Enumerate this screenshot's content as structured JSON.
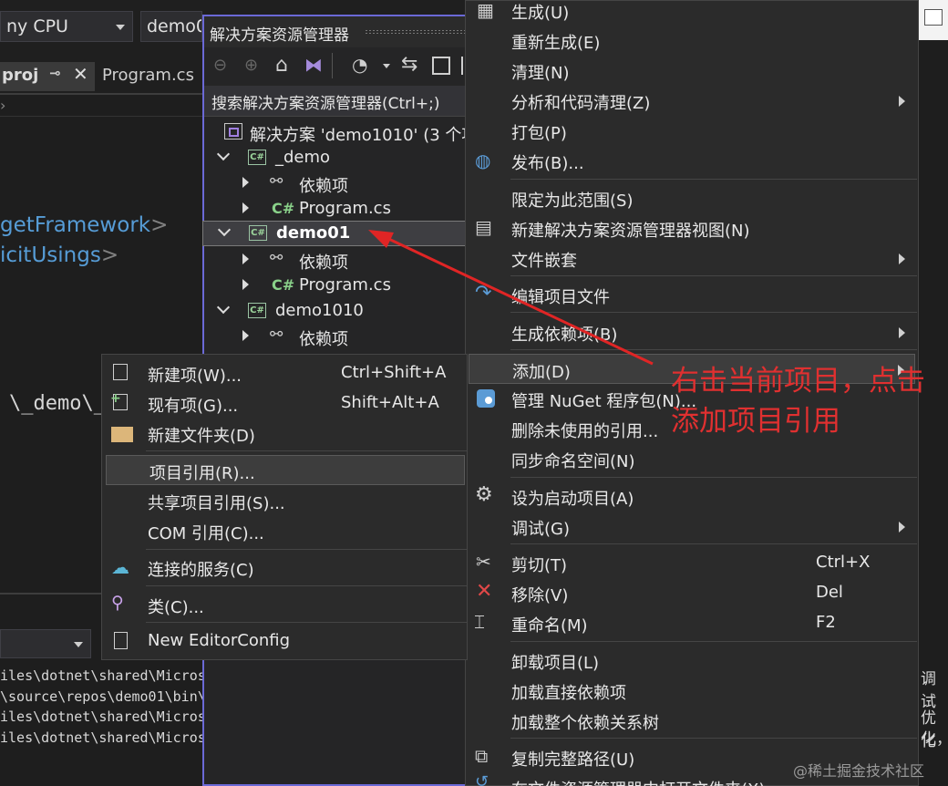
{
  "toolbar": {
    "platform_combo": "ny CPU",
    "project_combo": "demo0"
  },
  "tabs": [
    {
      "label": "proj"
    },
    {
      "label": "Program.cs"
    }
  ],
  "editor": {
    "line1": "getFramework",
    "line2": "icitUsings",
    "path_fragment": "\\_demo\\_"
  },
  "solution_explorer": {
    "title": "解决方案资源管理器",
    "search_placeholder": "搜索解决方案资源管理器(Ctrl+;)",
    "solution_label": "解决方案 'demo1010' (3 个项",
    "csharp_badge": "C#",
    "items": [
      {
        "label": "_demo"
      },
      {
        "label": "依赖项"
      },
      {
        "label": "Program.cs"
      },
      {
        "label": "demo01"
      },
      {
        "label": "依赖项"
      },
      {
        "label": "Program.cs"
      },
      {
        "label": "demo1010"
      },
      {
        "label": "依赖项"
      }
    ]
  },
  "context_menu": {
    "items": [
      {
        "label": "生成(U)"
      },
      {
        "label": "重新生成(E)"
      },
      {
        "label": "清理(N)"
      },
      {
        "label": "分析和代码清理(Z)"
      },
      {
        "label": "打包(P)"
      },
      {
        "label": "发布(B)..."
      },
      {
        "label": "限定为此范围(S)"
      },
      {
        "label": "新建解决方案资源管理器视图(N)"
      },
      {
        "label": "文件嵌套"
      },
      {
        "label": "编辑项目文件"
      },
      {
        "label": "生成依赖项(B)"
      },
      {
        "label": "添加(D)"
      },
      {
        "label": "管理 NuGet 程序包(N)..."
      },
      {
        "label": "删除未使用的引用..."
      },
      {
        "label": "同步命名空间(N)"
      },
      {
        "label": "设为启动项目(A)"
      },
      {
        "label": "调试(G)"
      },
      {
        "label": "剪切(T)",
        "shortcut": "Ctrl+X"
      },
      {
        "label": "移除(V)",
        "shortcut": "Del"
      },
      {
        "label": "重命名(M)",
        "shortcut": "F2"
      },
      {
        "label": "卸载项目(L)"
      },
      {
        "label": "加载直接依赖项"
      },
      {
        "label": "加载整个依赖关系树"
      },
      {
        "label": "复制完整路径(U)"
      },
      {
        "label": "在文件资源管理器中打开文件夹(X)"
      }
    ]
  },
  "add_submenu": {
    "items": [
      {
        "label": "新建项(W)...",
        "shortcut": "Ctrl+Shift+A"
      },
      {
        "label": "现有项(G)...",
        "shortcut": "Shift+Alt+A"
      },
      {
        "label": "新建文件夹(D)"
      },
      {
        "label": "项目引用(R)..."
      },
      {
        "label": "共享项目引用(S)..."
      },
      {
        "label": "COM 引用(C)..."
      },
      {
        "label": "连接的服务(C)"
      },
      {
        "label": "类(C)..."
      },
      {
        "label": "New EditorConfig"
      }
    ]
  },
  "output": {
    "lines": [
      "iles\\dotnet\\shared\\Micros",
      "\\source\\repos\\demo01\\bin\\",
      "iles\\dotnet\\shared\\Micros",
      "iles\\dotnet\\shared\\Micros"
    ]
  },
  "right_edge": {
    "text1": "调试",
    "text2": "优化",
    "text3": "化，"
  },
  "annotation": {
    "line1": "右击当前项目，点击",
    "line2": "添加项目引用"
  },
  "watermark": "@稀土掘金技术社区",
  "colors": {
    "accent_border": "#6b69d6",
    "annotation_red": "#e03030"
  }
}
